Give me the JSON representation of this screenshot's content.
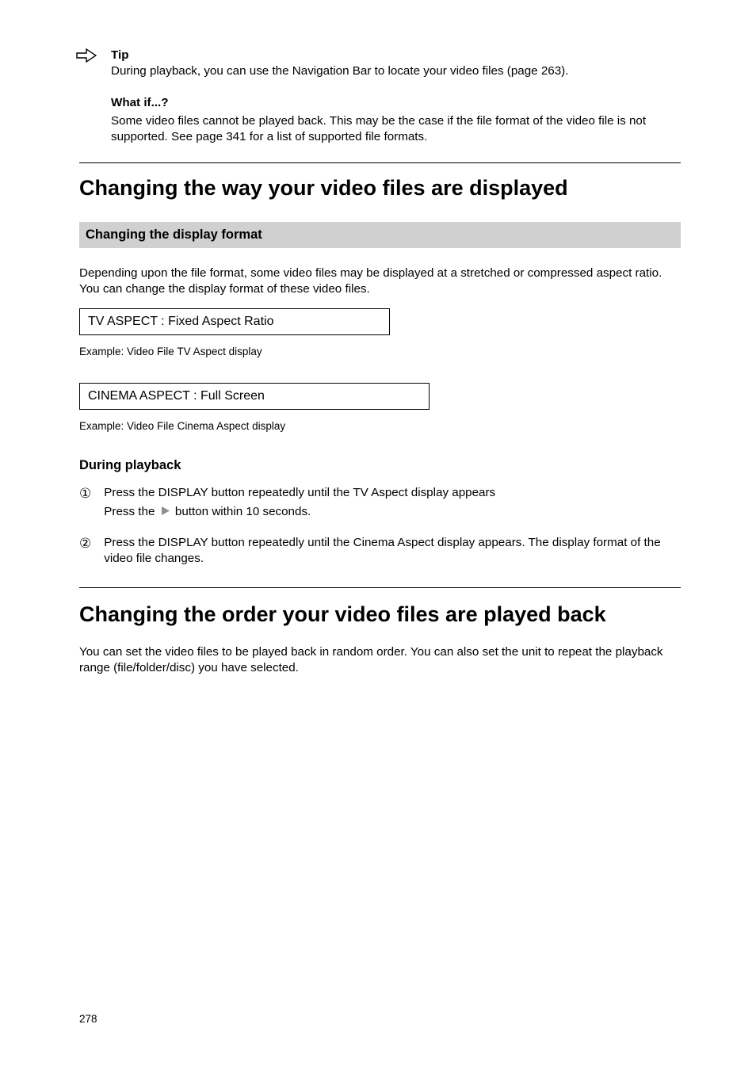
{
  "tip": {
    "label": "Tip",
    "text": "During playback, you can use the Navigation Bar to locate your video files (page 263)."
  },
  "what_if": {
    "heading": "What if...?",
    "text": "Some video files cannot be played back. This may be the case if the file format of the video file is not supported. See page 341 for a list of supported file formats."
  },
  "section": {
    "title": "Changing the way your video files are displayed",
    "band": "Changing the display format",
    "intro": "Depending upon the file format, some video files may be displayed at a stretched or compressed aspect ratio. You can change the display format of these video files.",
    "box1": "TV ASPECT :        Fixed Aspect Ratio",
    "box1_caption": "Example: Video File TV Aspect display",
    "box2": "CINEMA ASPECT :        Full Screen",
    "box2_caption": "Example: Video File Cinema Aspect display"
  },
  "steps": {
    "title": "During playback",
    "step1_a": "Press the DISPLAY button repeatedly until the TV Aspect display appears",
    "step1_b": "Press the button within 10 seconds.",
    "step2": "Press the DISPLAY button repeatedly until the Cinema Aspect display appears. The display format of the video file changes."
  },
  "section2": {
    "title": "Changing the order your video files are played back",
    "intro": "You can set the video files to be played back in random order. You can also set the unit to repeat the playback range (file/folder/disc) you have selected."
  },
  "page_number": "278",
  "icons": {
    "arrow": "arrow-right-outline",
    "play": "play-triangle"
  }
}
